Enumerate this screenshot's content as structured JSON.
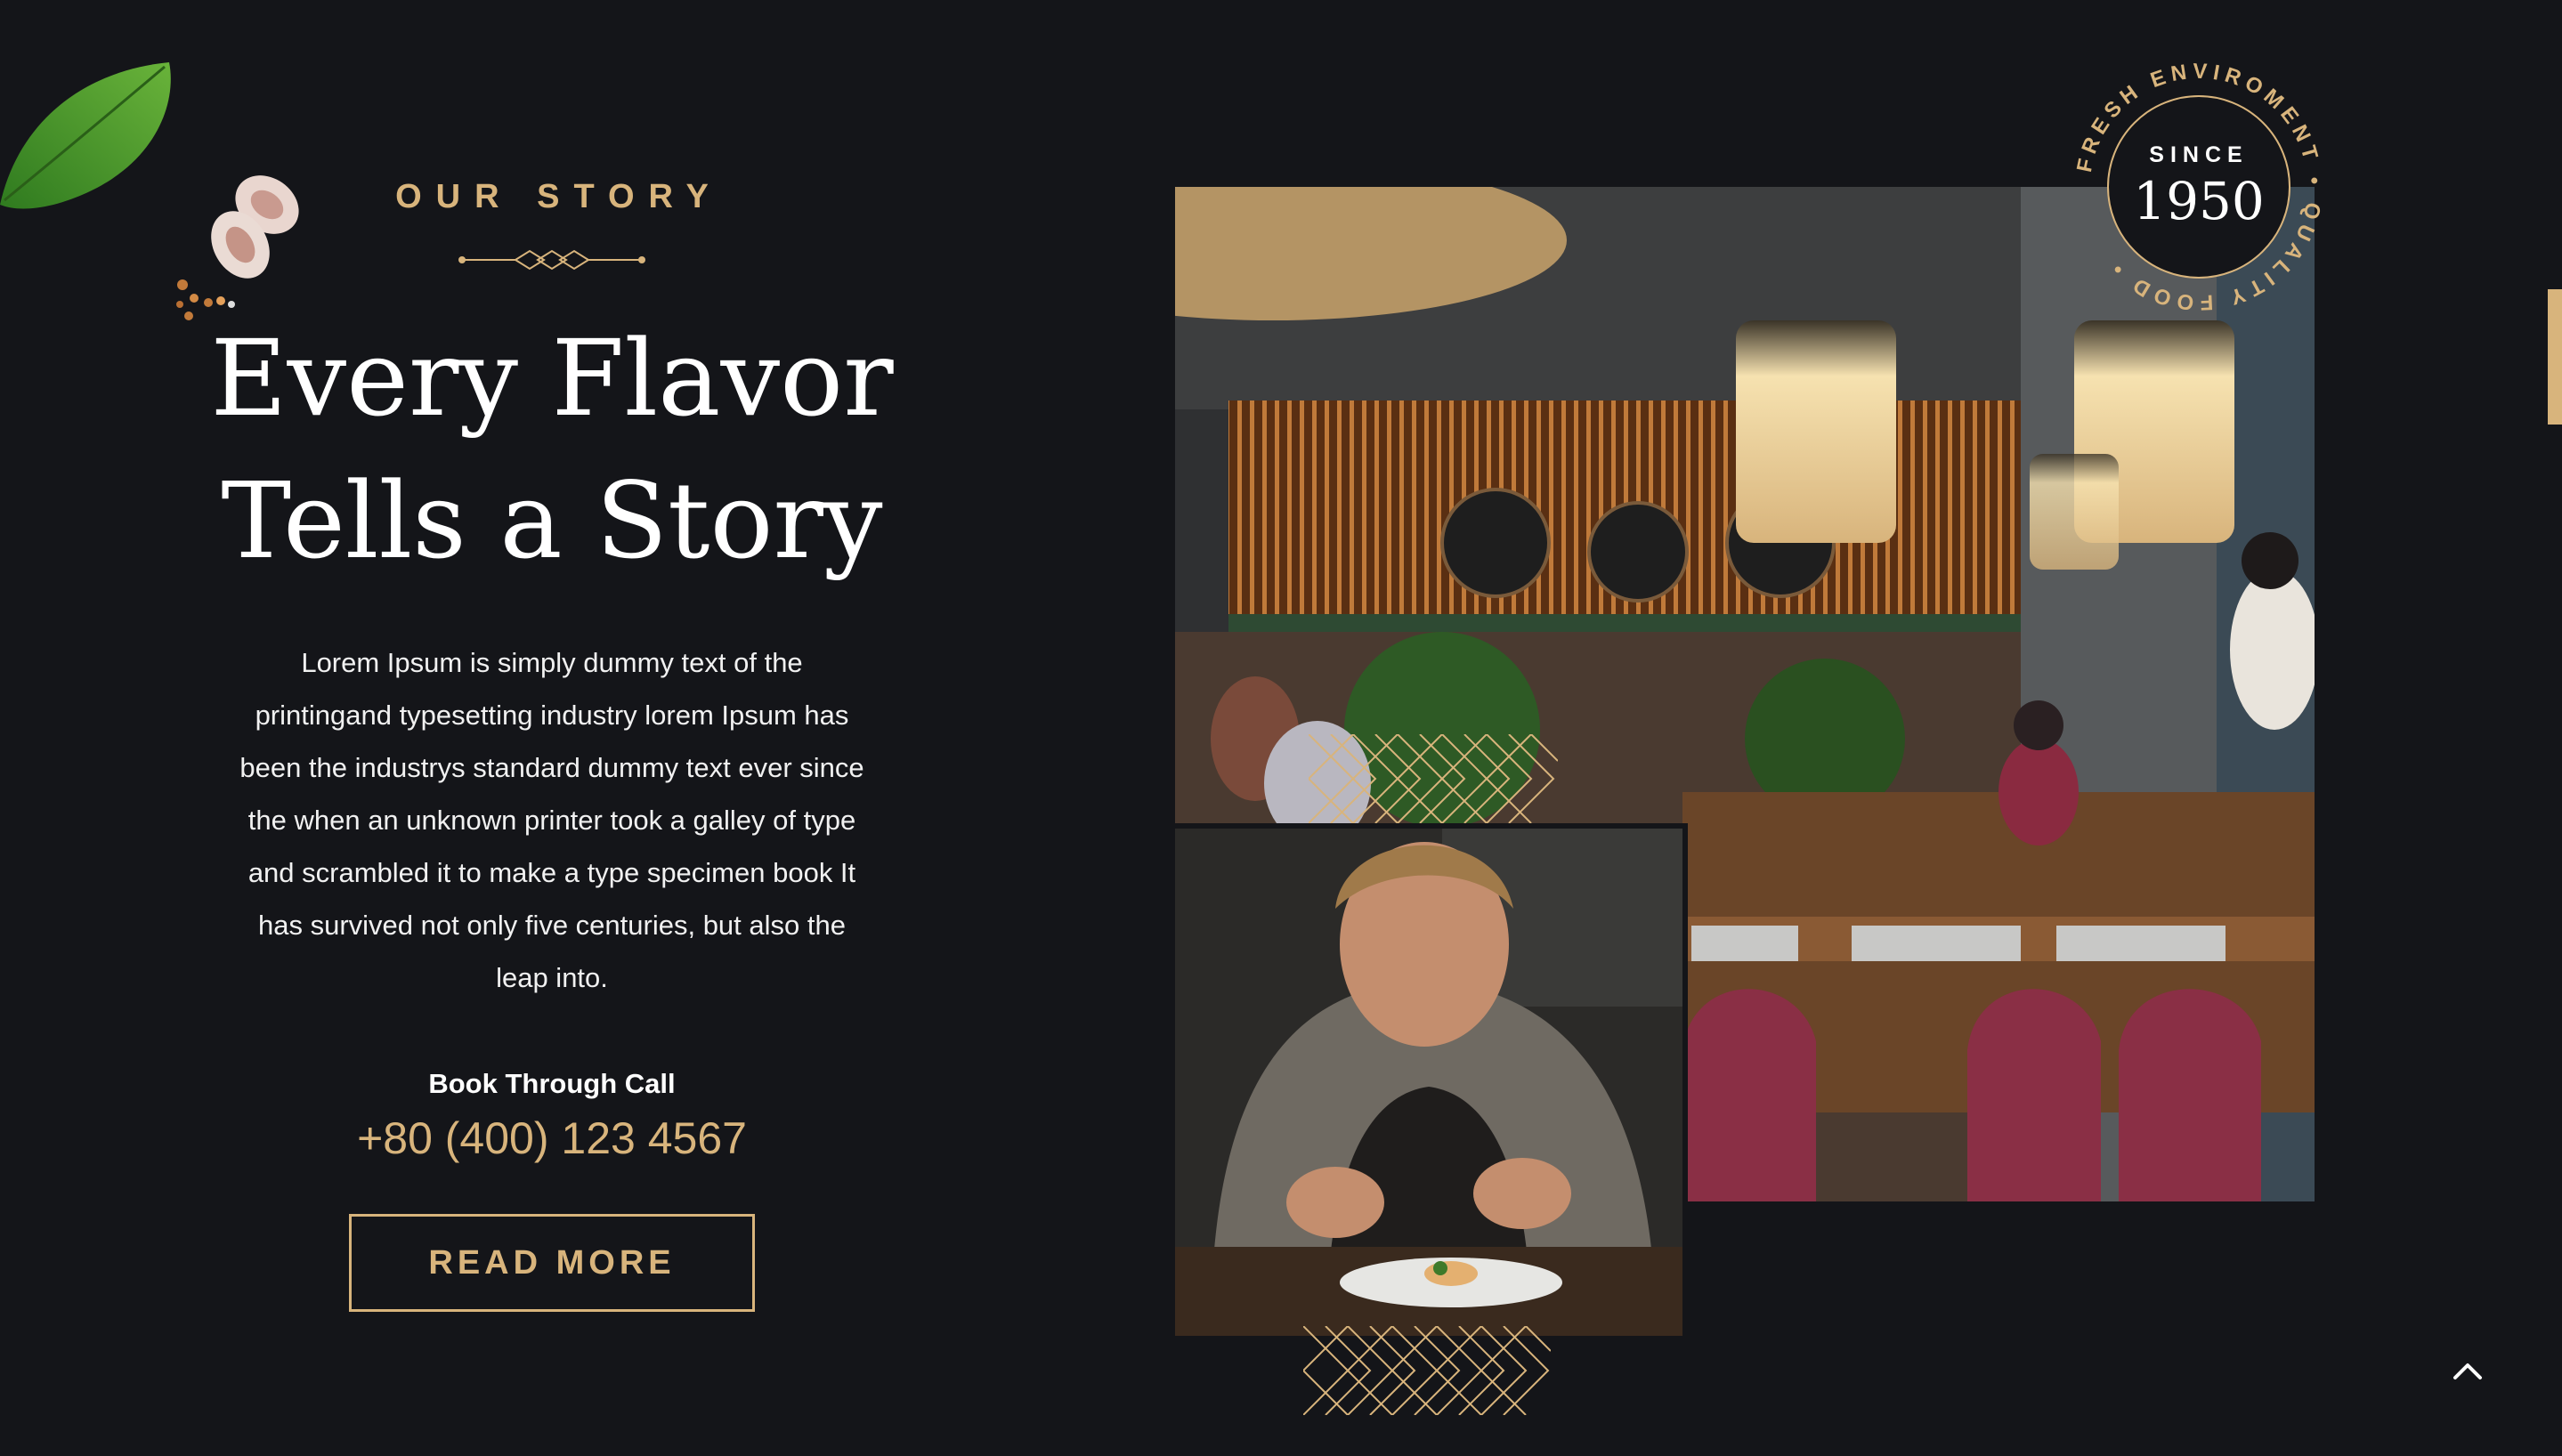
{
  "story": {
    "eyebrow": "OUR STORY",
    "headline_line1": "Every Flavor",
    "headline_line2": "Tells a Story",
    "body": "Lorem Ipsum is simply dummy text of the printingand typesetting industry lorem Ipsum has been the industrys standard dummy text ever since the when an unknown printer took a galley of type and scrambled it to make a type specimen book It has survived not only five centuries, but also the leap into.",
    "book_label": "Book Through Call",
    "phone": "+80 (400) 123 4567",
    "cta_label": "READ MORE"
  },
  "badge": {
    "ring_text": "FRESH ENVIROMENT • QUALITY FOOD •",
    "since_label": "SINCE",
    "year": "1950"
  },
  "icons": {
    "decoration_left": "basil-leaf-icon",
    "decoration_garlic": "garlic-icon",
    "scroll": "chevron-up-icon"
  },
  "colors": {
    "background": "#141519",
    "accent": "#d8b47c",
    "text": "#ffffff"
  }
}
